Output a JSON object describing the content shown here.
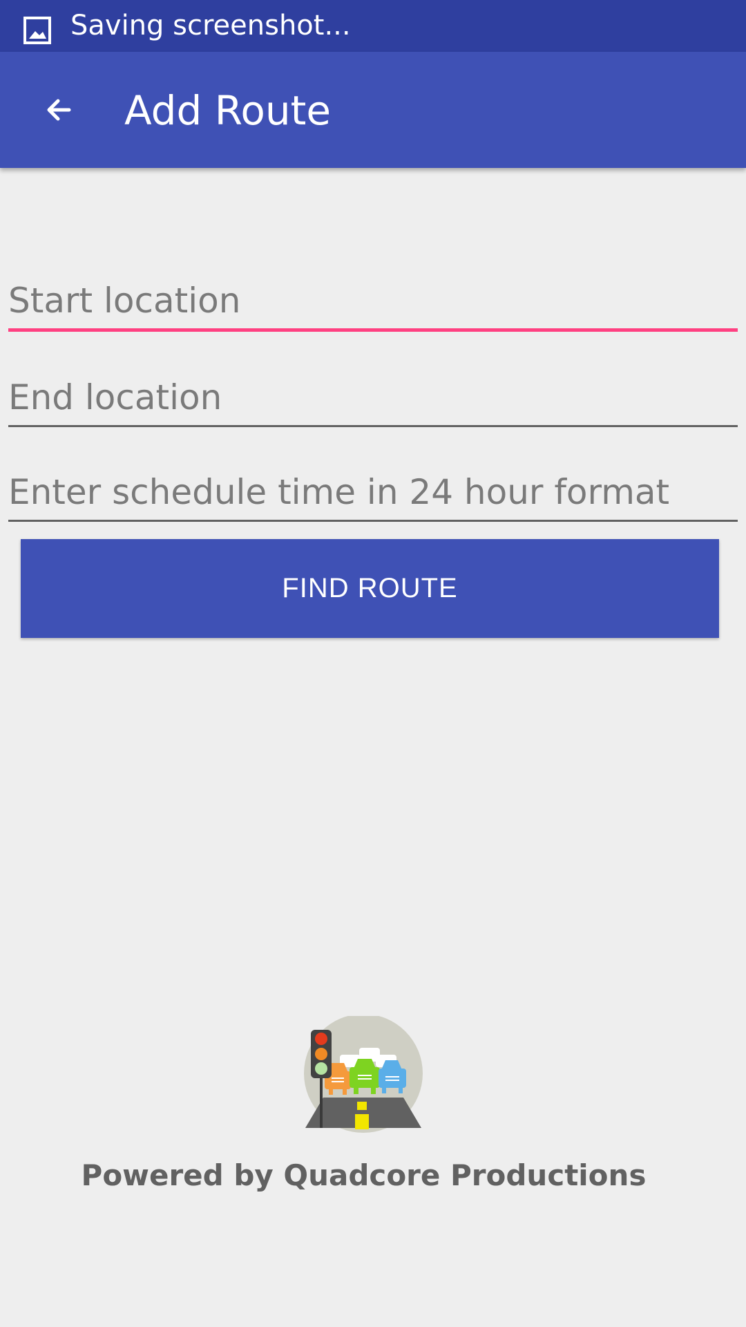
{
  "status_bar": {
    "notification_icon": "image-icon",
    "text": "Saving screenshot..."
  },
  "app_bar": {
    "back_icon": "arrow-left-icon",
    "title": "Add Route",
    "color": "#3f51b5"
  },
  "form": {
    "start_location": {
      "placeholder": "Start location",
      "value": "",
      "focused": true
    },
    "end_location": {
      "placeholder": "End location",
      "value": ""
    },
    "schedule_time": {
      "placeholder": "Enter schedule time in 24 hour format",
      "value": ""
    },
    "find_route_label": "FIND ROUTE",
    "accent_color": "#ff4081"
  },
  "footer": {
    "logo_icon": "traffic-jam-logo",
    "powered_by": "Powered by Quadcore Productions"
  }
}
